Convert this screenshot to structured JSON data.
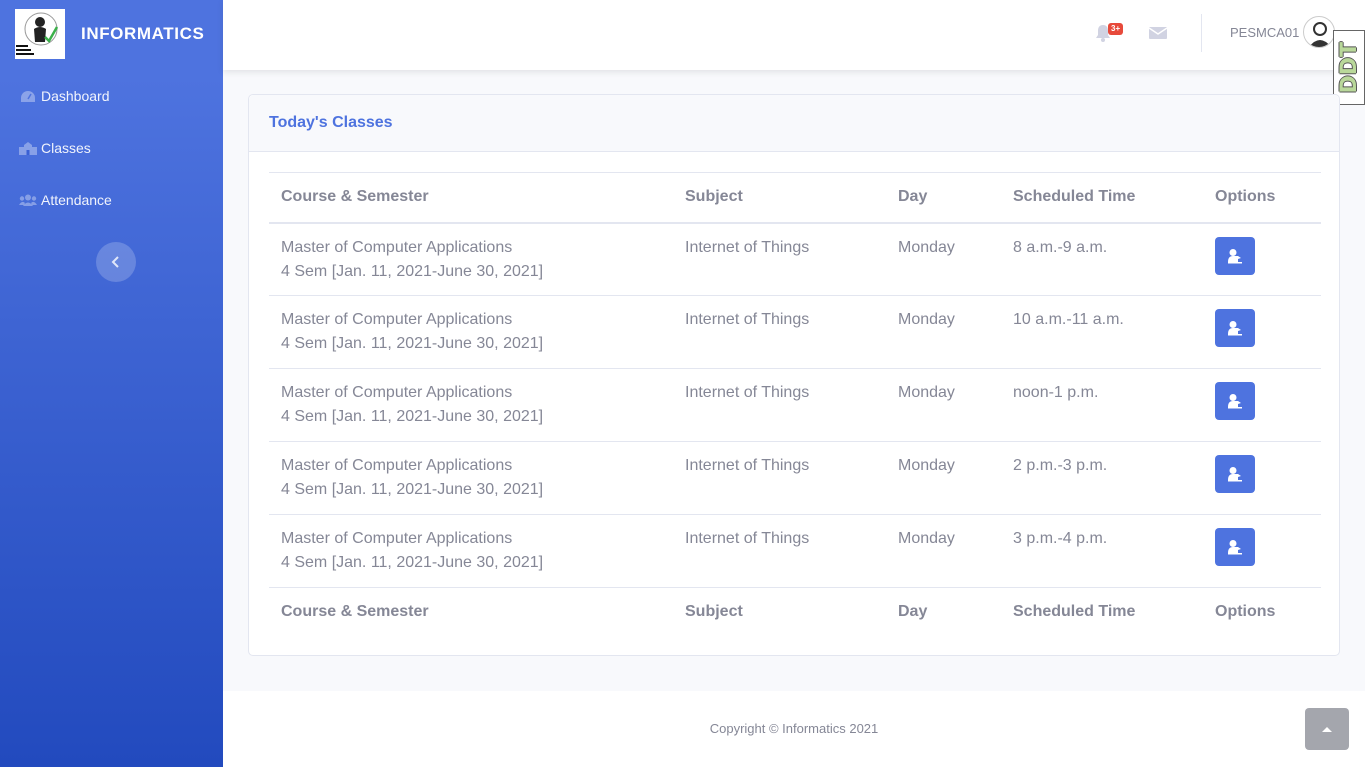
{
  "brand": {
    "name": "INFORMATICS"
  },
  "sidebar": {
    "items": [
      {
        "label": "Dashboard",
        "icon": "tachometer-icon"
      },
      {
        "label": "Classes",
        "icon": "school-icon"
      },
      {
        "label": "Attendance",
        "icon": "users-icon"
      }
    ],
    "toggle_icon": "chevron-left-icon"
  },
  "topbar": {
    "alerts_badge": "3+",
    "user_name": "PESMCA01",
    "side_tab_text": "DDT"
  },
  "card": {
    "title": "Today's Classes",
    "columns": [
      "Course & Semester",
      "Subject",
      "Day",
      "Scheduled Time",
      "Options"
    ],
    "rows": [
      {
        "course": "Master of Computer Applications",
        "semester": "4 Sem [Jan. 11, 2021-June 30, 2021]",
        "subject": "Internet of Things",
        "day": "Monday",
        "time": "8 a.m.-9 a.m."
      },
      {
        "course": "Master of Computer Applications",
        "semester": "4 Sem [Jan. 11, 2021-June 30, 2021]",
        "subject": "Internet of Things",
        "day": "Monday",
        "time": "10 a.m.-11 a.m."
      },
      {
        "course": "Master of Computer Applications",
        "semester": "4 Sem [Jan. 11, 2021-June 30, 2021]",
        "subject": "Internet of Things",
        "day": "Monday",
        "time": "noon-1 p.m."
      },
      {
        "course": "Master of Computer Applications",
        "semester": "4 Sem [Jan. 11, 2021-June 30, 2021]",
        "subject": "Internet of Things",
        "day": "Monday",
        "time": "2 p.m.-3 p.m."
      },
      {
        "course": "Master of Computer Applications",
        "semester": "4 Sem [Jan. 11, 2021-June 30, 2021]",
        "subject": "Internet of Things",
        "day": "Monday",
        "time": "3 p.m.-4 p.m."
      }
    ]
  },
  "footer": {
    "copyright": "Copyright © Informatics 2021"
  },
  "colors": {
    "primary": "#4e73df",
    "primary_dark": "#224abe",
    "text": "#858796",
    "danger": "#e74a3b"
  }
}
